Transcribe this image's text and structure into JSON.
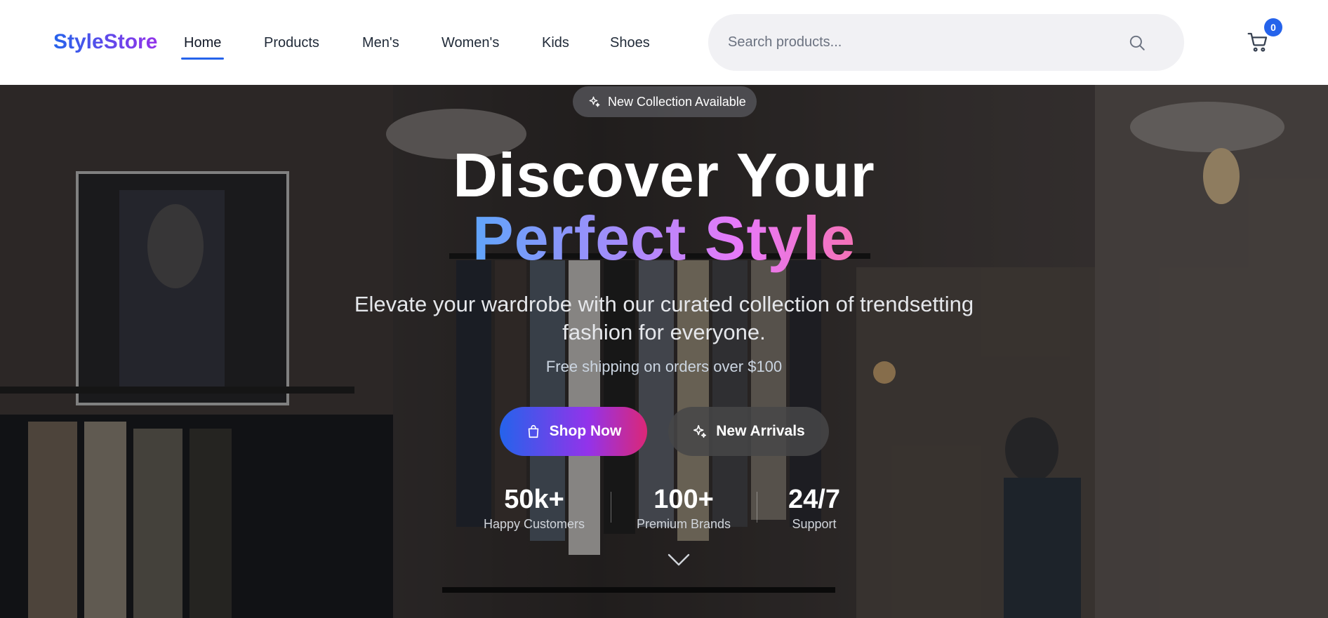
{
  "header": {
    "logo": "StyleStore",
    "nav": [
      {
        "label": "Home",
        "active": true
      },
      {
        "label": "Products",
        "active": false
      },
      {
        "label": "Men's",
        "active": false
      },
      {
        "label": "Women's",
        "active": false
      },
      {
        "label": "Kids",
        "active": false
      },
      {
        "label": "Shoes",
        "active": false
      }
    ],
    "search": {
      "placeholder": "Search products...",
      "value": ""
    },
    "cart": {
      "count": "0"
    }
  },
  "hero": {
    "badge": "New Collection Available",
    "title_line1": "Discover Your",
    "title_line2": "Perfect Style",
    "subtitle": "Elevate your wardrobe with our curated collection of trendsetting fashion for everyone.",
    "shipping": "Free shipping on orders over $100",
    "buttons": {
      "primary": "Shop Now",
      "secondary": "New Arrivals"
    },
    "stats": [
      {
        "value": "50k+",
        "label": "Happy Customers"
      },
      {
        "value": "100+",
        "label": "Premium Brands"
      },
      {
        "value": "24/7",
        "label": "Support"
      }
    ]
  },
  "colors": {
    "brand": "#4f46e5",
    "accent": "#2563eb",
    "gradient_start": "#2563eb",
    "gradient_end": "#db2777"
  },
  "icons": [
    "sparkle-icon",
    "search-icon",
    "cart-icon",
    "shopping-bag-icon",
    "chevron-down-icon"
  ]
}
